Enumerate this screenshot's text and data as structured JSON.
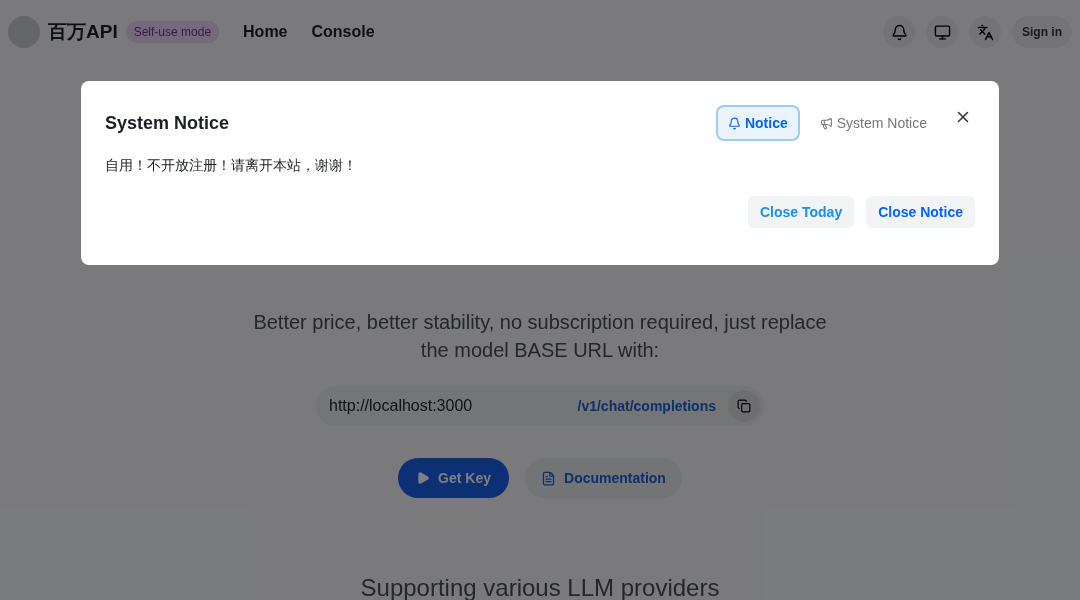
{
  "header": {
    "brand": "百万API",
    "badge": "Self-use mode",
    "nav": [
      "Home",
      "Console"
    ],
    "sign_in": "Sign in"
  },
  "hero": {
    "subtitle": "Better price, better stability, no subscription required, just replace the model BASE URL with:",
    "base_url": "http://localhost:3000",
    "endpoint": "/v1/chat/completions",
    "buttons": [
      {
        "label": "Get Key",
        "kind": "primary"
      },
      {
        "label": "Documentation",
        "kind": "secondary"
      }
    ],
    "supporting": "Supporting various LLM providers"
  },
  "modal": {
    "title": "System Notice",
    "tabs": [
      {
        "label": "Notice",
        "selected": true
      },
      {
        "label": "System Notice",
        "selected": false
      }
    ],
    "body": "自用！不开放注册！请离开本站，谢谢！",
    "buttons": [
      {
        "label": "Close Today",
        "kind": "light"
      },
      {
        "label": "Close Notice",
        "kind": "strong"
      }
    ]
  }
}
